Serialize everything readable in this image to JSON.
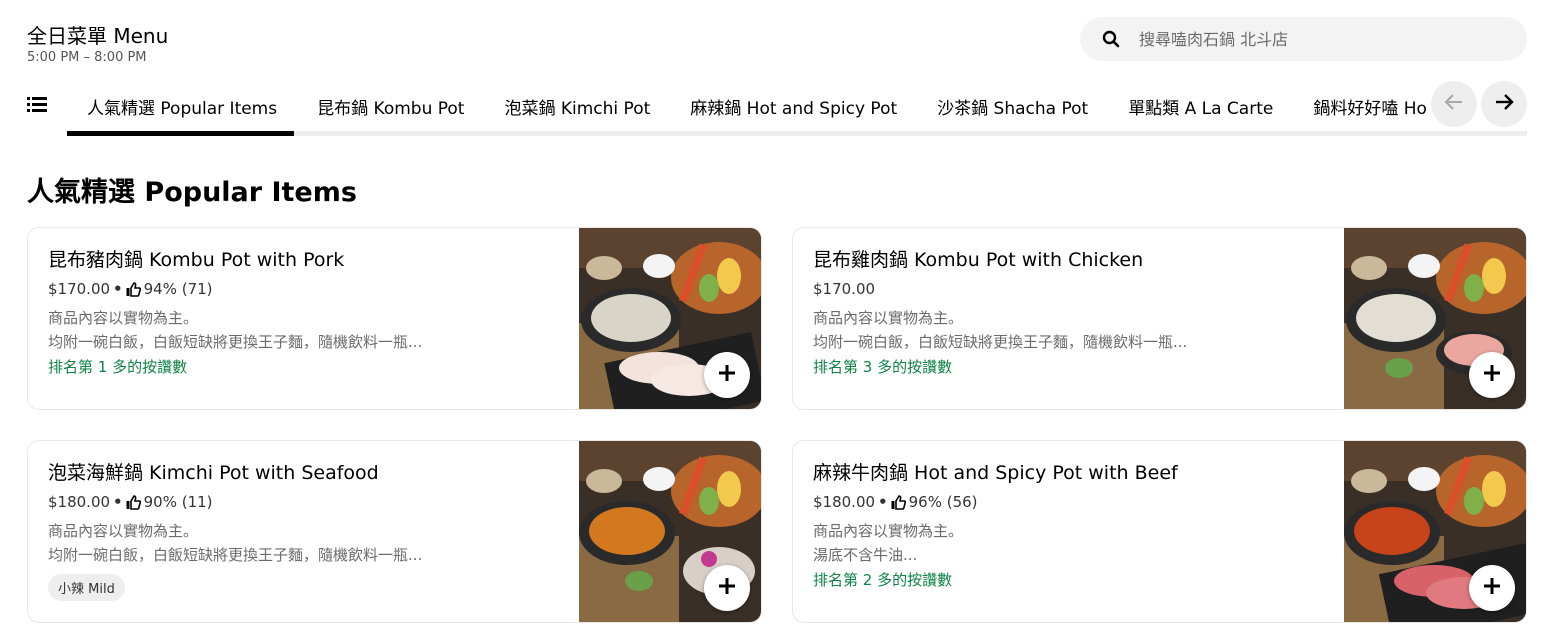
{
  "header": {
    "title": "全日菜單 Menu",
    "hours": "5:00 PM – 8:00 PM"
  },
  "search": {
    "placeholder": "搜尋嗑肉石鍋 北斗店",
    "icon": "search-icon"
  },
  "categories": {
    "tabs": [
      {
        "label": "人氣精選 Popular Items"
      },
      {
        "label": "昆布鍋 Kombu Pot"
      },
      {
        "label": "泡菜鍋 Kimchi Pot"
      },
      {
        "label": "麻辣鍋 Hot and Spicy Pot"
      },
      {
        "label": "沙茶鍋 Shacha Pot"
      },
      {
        "label": "單點類 A La Carte"
      },
      {
        "label": "鍋料好好嗑 Ho"
      }
    ],
    "active_index": 0,
    "prev_icon": "arrow-left-icon",
    "next_icon": "arrow-right-icon",
    "menu_icon": "list-icon"
  },
  "section": {
    "title": "人氣精選 Popular Items"
  },
  "items": [
    {
      "name": "昆布豬肉鍋 Kombu Pot with Pork",
      "price": "$170.00",
      "rating": "94% (71)",
      "desc1": "商品內容以實物為主。",
      "desc2": "均附一碗白飯，白飯短缺將更換王子麵，隨機飲料一瓶...",
      "rank": "排名第 1 多的按讚數"
    },
    {
      "name": "昆布雞肉鍋 Kombu Pot with Chicken",
      "price": "$170.00",
      "desc1": "商品內容以實物為主。",
      "desc2": "均附一碗白飯，白飯短缺將更換王子麵，隨機飲料一瓶...",
      "rank": "排名第 3 多的按讚數"
    },
    {
      "name": "泡菜海鮮鍋 Kimchi Pot with Seafood",
      "price": "$180.00",
      "rating": "90% (11)",
      "desc1": "商品內容以實物為主。",
      "desc2": "均附一碗白飯，白飯短缺將更換王子麵，隨機飲料一瓶...",
      "badge": "小辣 Mild"
    },
    {
      "name": "麻辣牛肉鍋 Hot and Spicy Pot with Beef",
      "price": "$180.00",
      "rating": "96% (56)",
      "desc1": "商品內容以實物為主。",
      "desc2": "湯底不含牛油...",
      "rank": "排名第 2 多的按讚數"
    }
  ],
  "colors": {
    "rank_green": "#0e8345",
    "kombu_broth": "#d9d4c8",
    "kimchi_broth": "#d2791f",
    "spicy_broth": "#c8421a"
  }
}
